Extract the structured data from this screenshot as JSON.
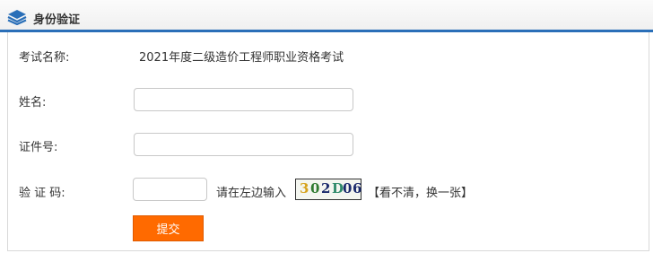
{
  "header": {
    "title": "身份验证",
    "icon": "layers-icon",
    "accent_color": "#2a6fb8"
  },
  "form": {
    "exam_label": "考试名称:",
    "exam_value": "2021年度二级造价工程师职业资格考试",
    "name_label": "姓名:",
    "name_value": "",
    "id_label": "证件号:",
    "id_value": "",
    "captcha_label": "验 证 码:",
    "captcha_value": "",
    "captcha_hint": "请在左边输入",
    "captcha_chars": [
      {
        "char": "3",
        "color": "#d6a21c"
      },
      {
        "char": "0",
        "color": "#2f7a2f"
      },
      {
        "char": "2",
        "color": "#1a2a6c"
      },
      {
        "char": "D",
        "color": "#2f8a6a"
      },
      {
        "char": "0",
        "color": "#1a2a6c"
      },
      {
        "char": "6",
        "color": "#1a2a6c"
      }
    ],
    "refresh_link": "【看不清，换一张】",
    "submit_label": "提交",
    "submit_color": "#ff6a00"
  }
}
